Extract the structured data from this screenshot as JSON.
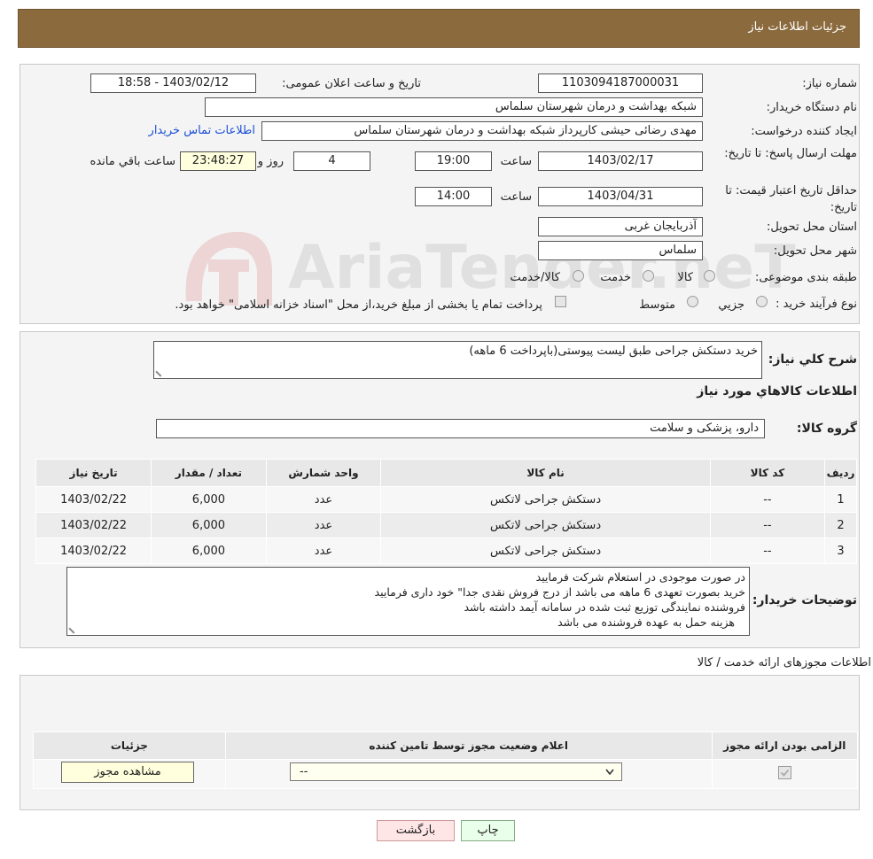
{
  "header": {
    "title": "جزئیات اطلاعات نیاز"
  },
  "watermark": {
    "text": "AriaTender.neT"
  },
  "form": {
    "need_number_label": "شماره نیاز:",
    "need_number": "1103094187000031",
    "announce_label": "تاریخ و ساعت اعلان عمومی:",
    "announce_value": "1403/02/12 - 18:58",
    "buyer_org_label": "نام دستگاه خریدار:",
    "buyer_org": "شبکه بهداشت و درمان  شهرستان سلماس",
    "requester_label": "ایجاد کننده درخواست:",
    "requester": "مهدی رضائی حیشی کارپرداز شبکه بهداشت و درمان  شهرستان سلماس",
    "contact_link": "اطلاعات تماس خریدار",
    "reply_deadline_label": "مهلت ارسال پاسخ: تا تاریخ:",
    "reply_date": "1403/02/17",
    "time_label": "ساعت",
    "reply_time": "19:00",
    "days_value": "4",
    "days_label": "روز و",
    "remaining_value": "23:48:27",
    "remaining_label": "ساعت باقي مانده",
    "price_validity_label": "حداقل تاریخ اعتبار قیمت: تا تاریخ:",
    "price_date": "1403/04/31",
    "price_time": "14:00",
    "province_label": "استان محل تحویل:",
    "province": "آذربایجان غربی",
    "city_label": "شهر محل تحویل:",
    "city": "سلماس",
    "category_label": "طبقه بندی موضوعی:",
    "category_options": [
      "کالا",
      "خدمت",
      "کالا/خدمت"
    ],
    "process_label": "نوع فرآیند خرید :",
    "process_options": [
      "جزیي",
      "متوسط"
    ],
    "payment_note": "پرداخت تمام یا بخشی از مبلغ خرید،از محل \"اسناد خزانه اسلامی\" خواهد بود."
  },
  "details": {
    "summary_label": "شرح کلي نياز:",
    "summary": "خرید دستکش جراحی طبق لیست پیوستی(باپرداخت 6 ماهه)",
    "goods_info_title": "اطلاعات کالاهاي مورد نياز",
    "goods_group_label": "گروه کالا:",
    "goods_group": "دارو، پزشکی و سلامت",
    "table": {
      "headers": [
        "رديف",
        "کد کالا",
        "نام کالا",
        "واحد شمارش",
        "تعداد / مقدار",
        "تاريخ نياز"
      ],
      "rows": [
        [
          "1",
          "--",
          "دستکش جراحی لاتکس",
          "عدد",
          "6,000",
          "1403/02/22"
        ],
        [
          "2",
          "--",
          "دستکش جراحی لاتکس",
          "عدد",
          "6,000",
          "1403/02/22"
        ],
        [
          "3",
          "--",
          "دستکش جراحی لاتکس",
          "عدد",
          "6,000",
          "1403/02/22"
        ]
      ]
    },
    "buyer_notes_label": "توضیحات خریدار:",
    "buyer_notes": [
      "در صورت موجودی در استعلام شرکت فرمایید",
      "خرید بصورت تعهدی 6 ماهه می باشد از درج فروش نقدی جدا\" خود داری فرمایید",
      "فروشنده نمایندگی توزیع ثبت شده در سامانه آیمد داشته باشد",
      "هزینه حمل به عهده فروشنده می باشد"
    ]
  },
  "permits": {
    "title": "اطلاعات مجوزهای ارائه خدمت / کالا",
    "headers": [
      "الزامی بودن ارائه مجوز",
      "اعلام وضعیت مجوز توسط تامین کننده",
      "جزئیات"
    ],
    "select_value": "--",
    "view_button": "مشاهده مجوز"
  },
  "actions": {
    "print": "چاپ",
    "back": "بازگشت"
  }
}
